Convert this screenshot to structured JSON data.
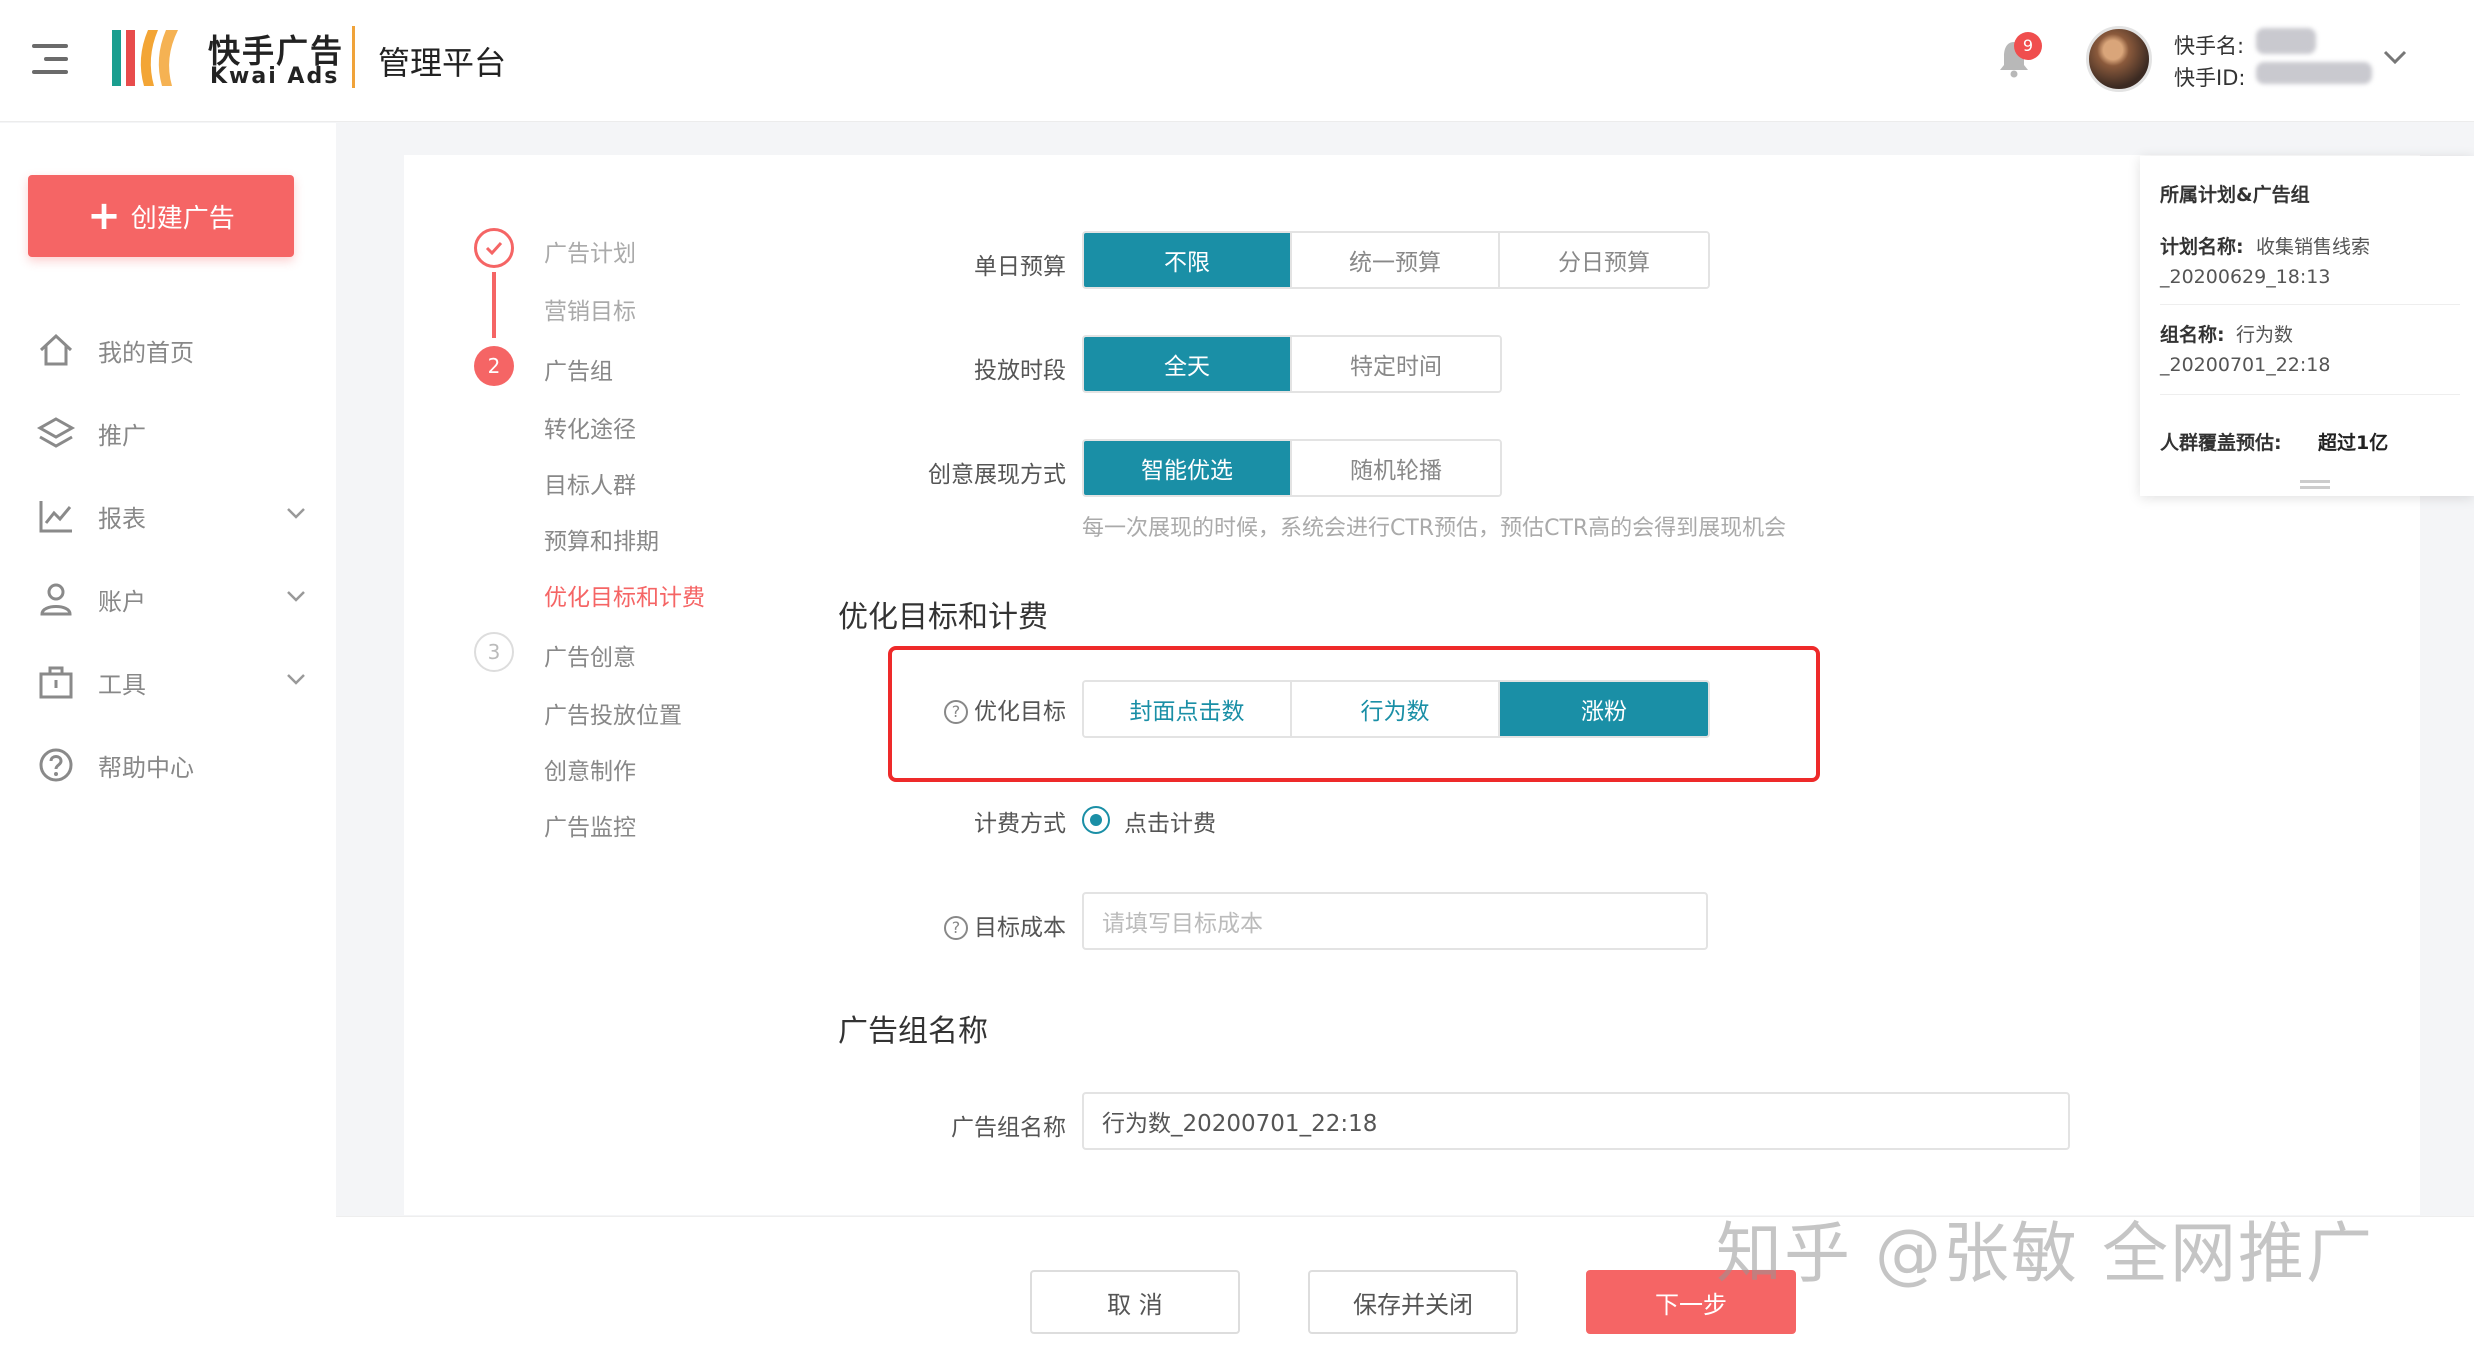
{
  "header": {
    "logo_cn": "快手广告",
    "logo_en": "Kwai Ads",
    "platform": "管理平台",
    "notification_count": "9",
    "user_name_label": "快手名:",
    "user_id_label": "快手ID:"
  },
  "sidebar": {
    "create_label": "创建广告",
    "items": [
      {
        "label": "我的首页",
        "icon": "home-icon"
      },
      {
        "label": "推广",
        "icon": "layers-icon"
      },
      {
        "label": "报表",
        "icon": "chart-icon"
      },
      {
        "label": "账户",
        "icon": "user-icon"
      },
      {
        "label": "工具",
        "icon": "toolbox-icon"
      },
      {
        "label": "帮助中心",
        "icon": "help-icon"
      }
    ]
  },
  "steps": {
    "step1_label": "广告计划",
    "step1_sub": "营销目标",
    "step2_num": "2",
    "step2_label": "广告组",
    "step2_subs": [
      "转化途径",
      "目标人群",
      "预算和排期",
      "优化目标和计费"
    ],
    "step3_num": "3",
    "step3_label": "广告创意",
    "step3_subs": [
      "广告投放位置",
      "创意制作",
      "广告监控"
    ]
  },
  "form": {
    "daily_budget_label": "单日预算",
    "daily_budget_options": [
      "不限",
      "统一预算",
      "分日预算"
    ],
    "time_label": "投放时段",
    "time_options": [
      "全天",
      "特定时间"
    ],
    "creative_label": "创意展现方式",
    "creative_options": [
      "智能优选",
      "随机轮播"
    ],
    "creative_hint": "每一次展现的时候，系统会进行CTR预估，预估CTR高的会得到展现机会",
    "section_optimize": "优化目标和计费",
    "optimize_label": "优化目标",
    "optimize_options": [
      "封面点击数",
      "行为数",
      "涨粉"
    ],
    "billing_label": "计费方式",
    "billing_value": "点击计费",
    "target_cost_label": "目标成本",
    "target_cost_placeholder": "请填写目标成本",
    "section_group_name": "广告组名称",
    "group_name_label": "广告组名称",
    "group_name_value": "行为数_20200701_22:18"
  },
  "info_panel": {
    "title": "所属计划&广告组",
    "plan_label": "计划名称:",
    "plan_value_1": "收集销售线索",
    "plan_value_2": "_20200629_18:13",
    "group_label": "组名称:",
    "group_value_1": "行为数",
    "group_value_2": "_20200701_22:18",
    "audience_label": "人群覆盖预估:",
    "audience_value": "超过1亿"
  },
  "footer": {
    "cancel": "取 消",
    "save_close": "保存并关闭",
    "next": "下一步"
  },
  "watermark": "知乎 @张敏 全网推广",
  "colors": {
    "accent_red": "#f56565",
    "teal": "#1a8fa6",
    "highlight_red": "#ee2a2a"
  }
}
